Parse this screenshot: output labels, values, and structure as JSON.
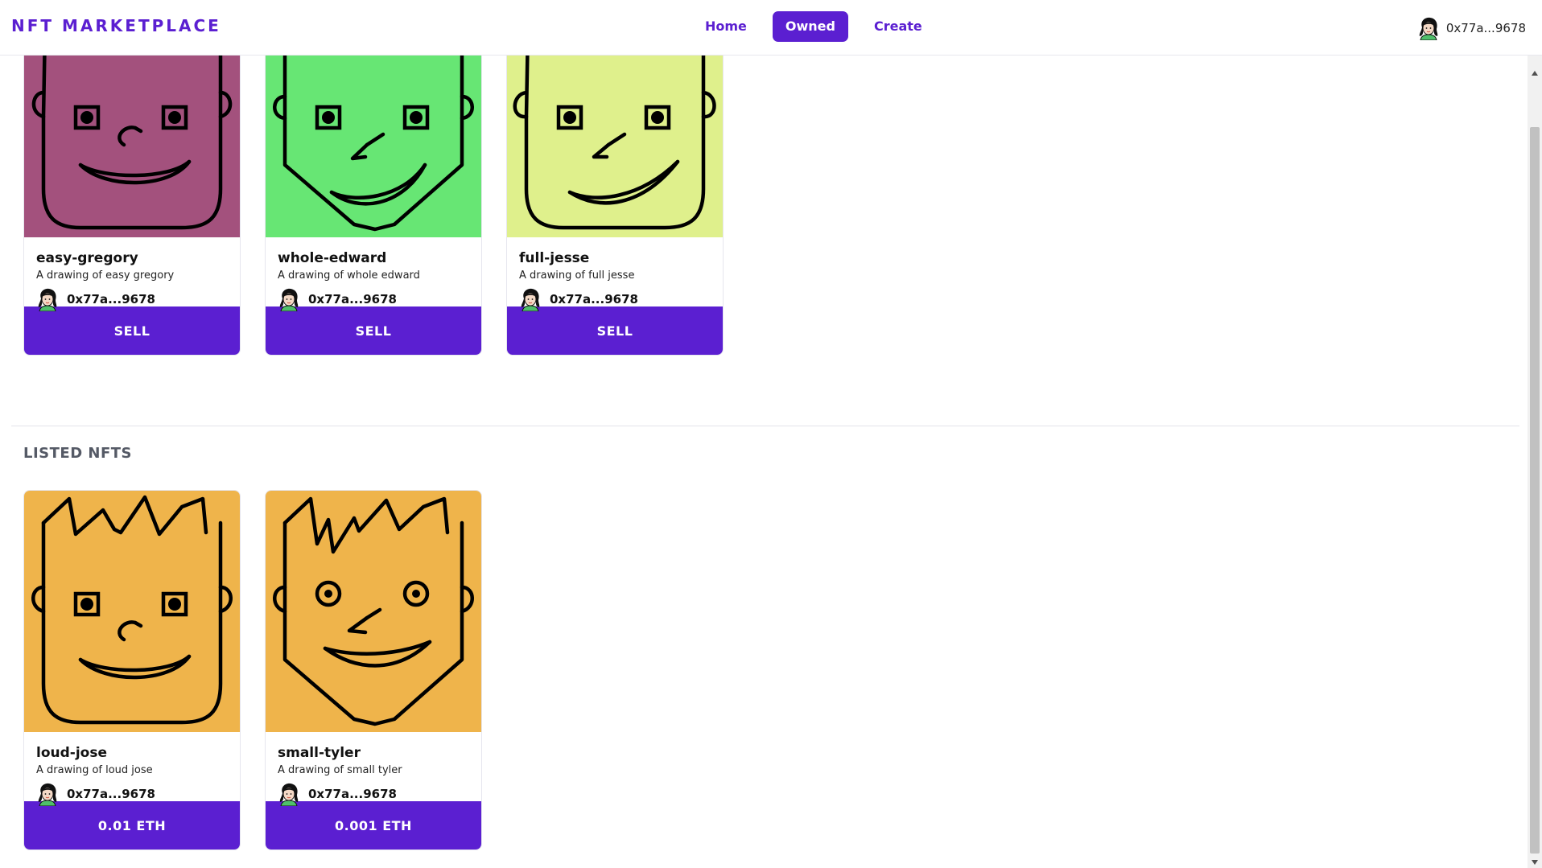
{
  "brand": "NFT MARKETPLACE",
  "nav": {
    "home": "Home",
    "owned": "Owned",
    "create": "Create"
  },
  "account": {
    "address": "0x77a...9678"
  },
  "colors": {
    "accent": "#5b1fd1"
  },
  "owned_nfts": [
    {
      "name": "easy-gregory",
      "description": "A drawing of easy gregory",
      "owner": "0x77a...9678",
      "action": "SELL",
      "bg": "#a3517d"
    },
    {
      "name": "whole-edward",
      "description": "A drawing of whole edward",
      "owner": "0x77a...9678",
      "action": "SELL",
      "bg": "#67e674"
    },
    {
      "name": "full-jesse",
      "description": "A drawing of full jesse",
      "owner": "0x77a...9678",
      "action": "SELL",
      "bg": "#dff08c"
    }
  ],
  "listed_section_title": "LISTED NFTS",
  "listed_nfts": [
    {
      "name": "loud-jose",
      "description": "A drawing of loud jose",
      "owner": "0x77a...9678",
      "action": "0.01 ETH",
      "bg": "#efb44b"
    },
    {
      "name": "small-tyler",
      "description": "A drawing of small tyler",
      "owner": "0x77a...9678",
      "action": "0.001 ETH",
      "bg": "#efb44b"
    }
  ]
}
